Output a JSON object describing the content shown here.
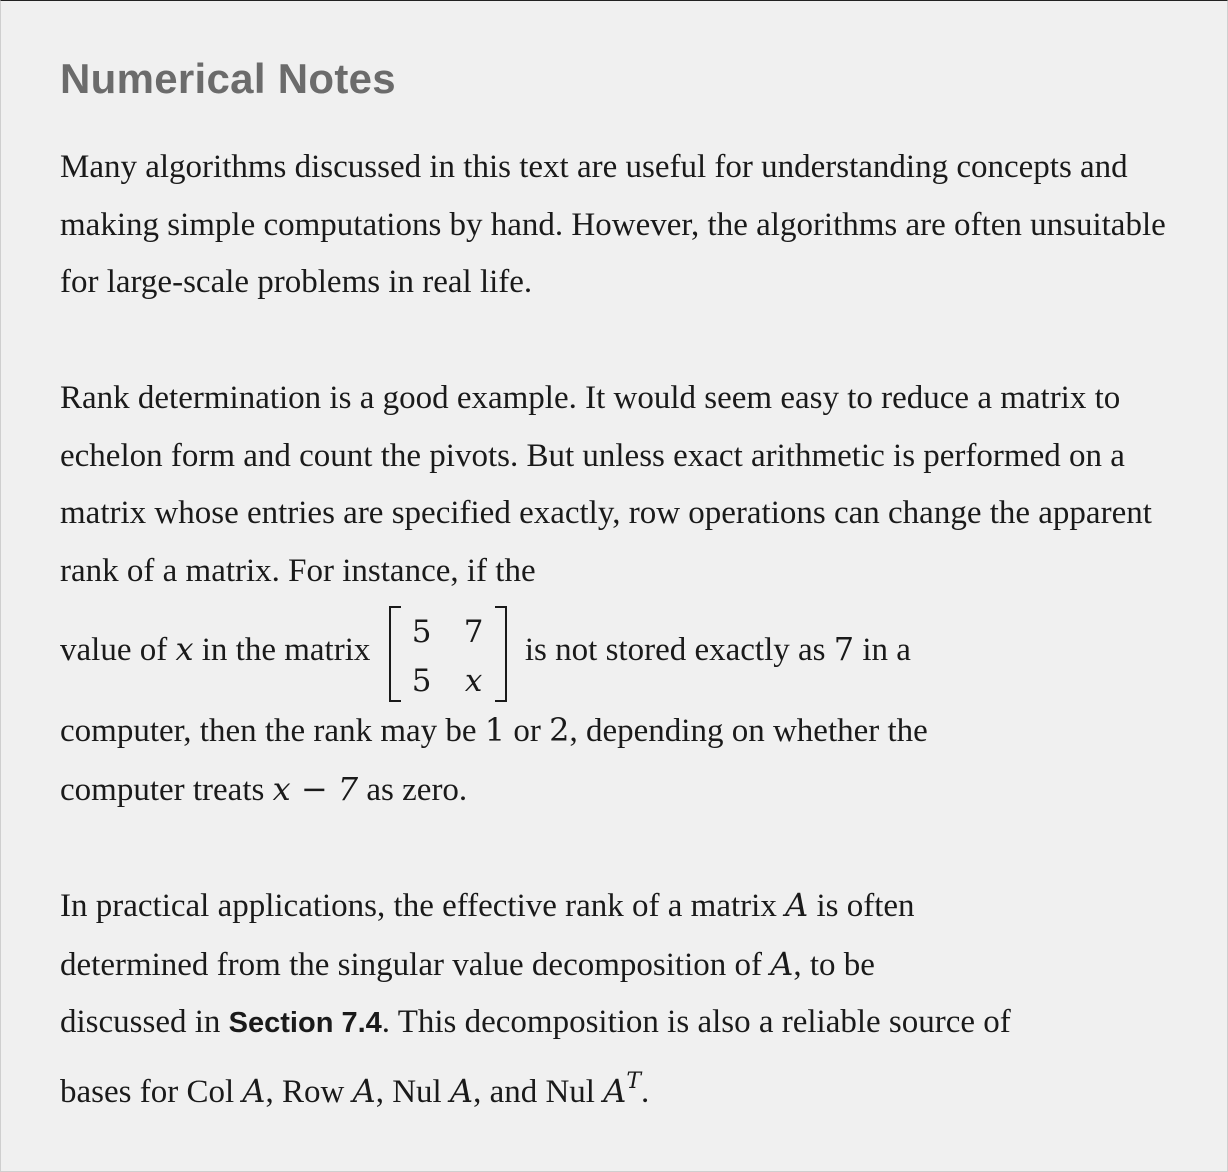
{
  "heading": "Numerical Notes",
  "p1": "Many algorithms discussed in this text are useful for understanding concepts and making simple computations by hand. However, the algorithms are often unsuitable for large-scale problems in real life.",
  "p2": {
    "text1": "Rank determination is a good example. It would seem easy to reduce a matrix to echelon form and count the pivots. But unless exact arithmetic is performed on a matrix whose entries are specified exactly, row operations can change the apparent rank of a matrix. For instance, if the",
    "pre_x": "value of ",
    "x": "x",
    "mid": " in the matrix",
    "matrix": {
      "a11": "5",
      "a12": "7",
      "a21": "5",
      "a22": "x"
    },
    "post_matrix": "is not stored exactly as ",
    "seven": "7",
    "in_a": " in a",
    "line_c1": "computer, then the rank may be ",
    "one": "1",
    "or": " or ",
    "two": "2",
    "line_c2": ", depending on whether the",
    "line_d1": "computer treats ",
    "expr": "x − 7",
    "line_d2": " as zero."
  },
  "p3": {
    "t1": "In practical applications, the effective rank of a matrix ",
    "A": "A",
    "t2": " is often",
    "t3": "determined from the singular value decomposition of ",
    "t4": ", to be",
    "t5": "discussed in ",
    "section": "Section 7.4",
    "t6": ". This decomposition is also a reliable source of",
    "t7": "bases for Col ",
    "comma": ", ",
    "row": "Row ",
    "nul": "Nul ",
    "and_nul": "and Nul ",
    "T": "T",
    "end": "."
  }
}
